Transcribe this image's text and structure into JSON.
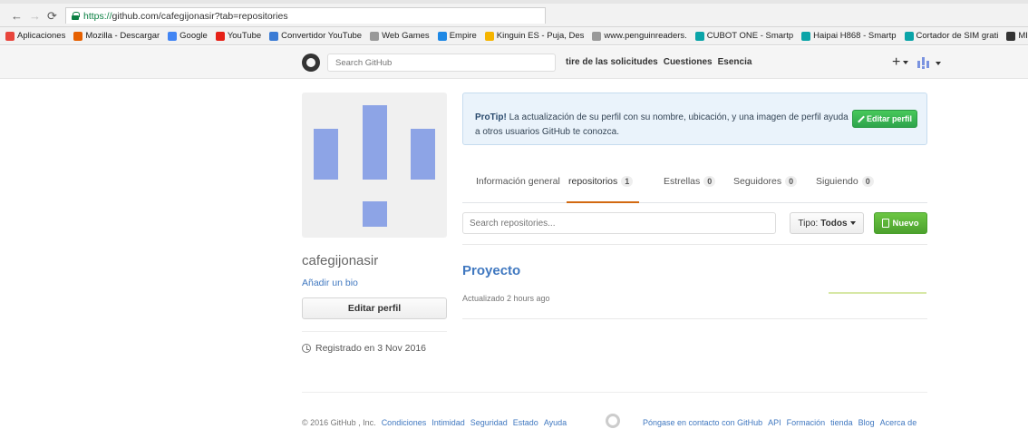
{
  "browser": {
    "url_scheme": "https://",
    "url_rest": "github.com/cafegijonasir?tab=repositories",
    "bookmarks": [
      {
        "label": "Aplicaciones",
        "color": "#e8453c"
      },
      {
        "label": "Mozilla - Descargar",
        "color": "#e66000"
      },
      {
        "label": "Google",
        "color": "#4285f4"
      },
      {
        "label": "YouTube",
        "color": "#e62117"
      },
      {
        "label": "Convertidor YouTube",
        "color": "#3a7bd5"
      },
      {
        "label": "Web Games",
        "color": "#999999"
      },
      {
        "label": "Empire",
        "color": "#1e88e5"
      },
      {
        "label": "Kinguin ES - Puja, Des",
        "color": "#f5b400"
      },
      {
        "label": "www.penguinreaders.",
        "color": "#999999"
      },
      {
        "label": "CUBOT ONE - Smartp",
        "color": "#0aa4a8"
      },
      {
        "label": "Haipai H868 - Smartp",
        "color": "#0aa4a8"
      },
      {
        "label": "Cortador de SIM grati",
        "color": "#0aa4a8"
      },
      {
        "label": "MIL ANUNCIOS.COM",
        "color": "#333333"
      }
    ]
  },
  "header": {
    "search_placeholder": "Search GitHub",
    "nav": [
      "tire de las solicitudes",
      "Cuestiones",
      "Esencia"
    ]
  },
  "profile": {
    "username": "cafegijonasir",
    "add_bio": "Añadir un bio",
    "edit_profile": "Editar perfil",
    "joined": "Registrado en 3 Nov 2016"
  },
  "protip": {
    "label": "ProTip!",
    "text": " La actualización de su perfil con su nombre, ubicación, y una imagen de perfil ayuda a otros usuarios GitHub te conozca.",
    "button": "Editar perfil"
  },
  "tabs": [
    {
      "label": "Información general",
      "count": null
    },
    {
      "label": "repositorios",
      "count": "1"
    },
    {
      "label": "Estrellas",
      "count": "0"
    },
    {
      "label": "Seguidores",
      "count": "0"
    },
    {
      "label": "Siguiendo",
      "count": "0"
    }
  ],
  "repos": {
    "search_placeholder": "Search repositories...",
    "type_label": "Tipo:",
    "type_value": "Todos",
    "new_button": "Nuevo",
    "items": [
      {
        "name": "Proyecto",
        "updated": "Actualizado 2 hours ago"
      }
    ]
  },
  "footer": {
    "copyright": "© 2016 GitHub , Inc.",
    "left_links": [
      "Condiciones",
      "Intimidad",
      "Seguridad",
      "Estado",
      "Ayuda"
    ],
    "right_links": [
      "Póngase en contacto con GitHub",
      "API",
      "Formación",
      "tienda",
      "Blog",
      "Acerca de"
    ]
  },
  "colors": {
    "link": "#4078c0",
    "green": "#6cc644",
    "active_tab": "#d26911"
  }
}
